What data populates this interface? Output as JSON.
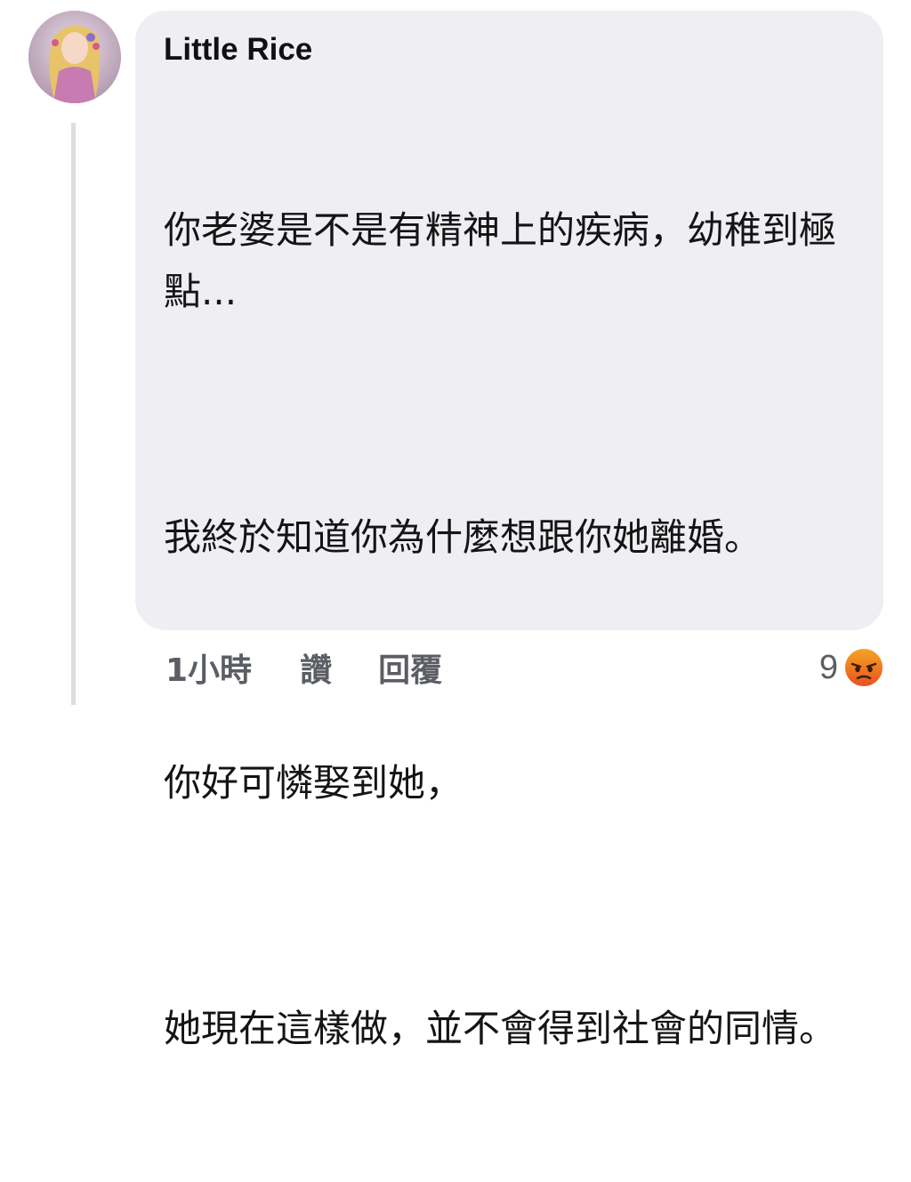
{
  "comment": {
    "author": "Little Rice",
    "paragraphs": [
      "你老婆是不是有精神上的疾病，幼稚到極點...",
      "我終於知道你為什麼想跟你她離婚。",
      "你好可憐娶到她，",
      "她現在這樣做，並不會得到社會的同情。"
    ],
    "timestamp": "1小時",
    "like_label": "讚",
    "reply_label": "回覆",
    "reaction_count": "9",
    "reaction_icon": "angry-face-icon"
  },
  "colors": {
    "bubble_bg": "#efeff3",
    "text": "#141414",
    "meta_text": "#5b5e63",
    "angry_top": "#f5a623",
    "angry_bottom": "#e8501e"
  }
}
